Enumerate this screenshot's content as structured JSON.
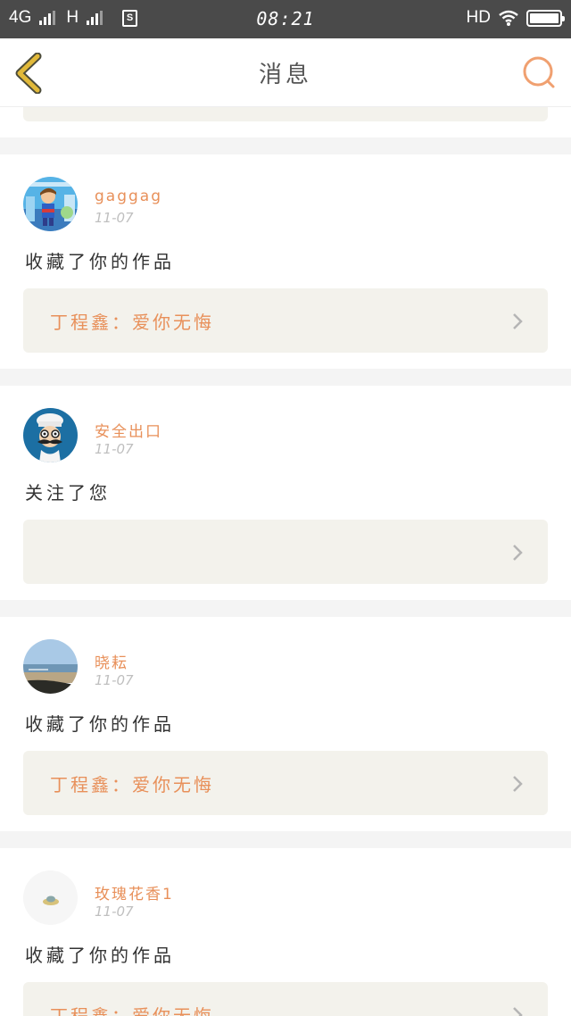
{
  "status_bar": {
    "network_4g": "4G",
    "network_h": "H",
    "sim_label": "S",
    "time": "08:21",
    "hd": "HD"
  },
  "header": {
    "title": "消息",
    "back_icon": "chevron-left-icon",
    "search_icon": "search-icon"
  },
  "colors": {
    "accent": "#e8905a",
    "back_icon": "#e1b93a",
    "card_bg": "#f3f2ec",
    "status_bar": "#4a4a4a"
  },
  "messages": [
    {
      "user": "gaggag",
      "date": "11-07",
      "action": "收藏了你的作品",
      "work": "丁程鑫：爱你无悔",
      "avatar": "cartoon-avatar"
    },
    {
      "user": "安全出口",
      "date": "11-07",
      "action": "关注了您",
      "work": "",
      "avatar": "mustache-chef-avatar"
    },
    {
      "user": "晓耘",
      "date": "11-07",
      "action": "收藏了你的作品",
      "work": "丁程鑫：爱你无悔",
      "avatar": "beach-avatar"
    },
    {
      "user": "玫瑰花香1",
      "date": "11-07",
      "action": "收藏了你的作品",
      "work": "丁程鑫：爱你无悔",
      "avatar": "hat-avatar"
    }
  ]
}
